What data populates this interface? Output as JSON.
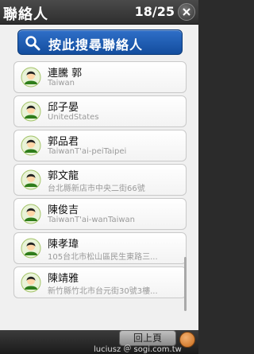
{
  "header": {
    "title": "聯絡人",
    "count": "18/25"
  },
  "search": {
    "label": "按此搜尋聯絡人"
  },
  "contacts": [
    {
      "name": "連騰 郭",
      "sub": "Taiwan"
    },
    {
      "name": "邱子晏",
      "sub": "UnitedStates"
    },
    {
      "name": "郭品君",
      "sub": "TaiwanT'ai-peiTaipei"
    },
    {
      "name": "郭文龍",
      "sub": "台北縣新店市中央二街66號"
    },
    {
      "name": "陳俊吉",
      "sub": "TaiwanT'ai-wanTaiwan"
    },
    {
      "name": "陳孝瑋",
      "sub": "105台北市松山區民生東路三..."
    },
    {
      "name": "陳靖雅",
      "sub": "新竹縣竹北市台元街30號3樓..."
    }
  ],
  "bottom": {
    "prev_label": "回上頁",
    "watermark": "luciusz ＠ sogi.com.tw"
  },
  "icons": {
    "close": "close-icon",
    "search": "search-icon",
    "avatar": "person-avatar-icon",
    "corner": "app-icon"
  },
  "colors": {
    "search_button": "#1f5fb8",
    "header": "#3a3a3a",
    "list_bg": "#f0f0f0"
  }
}
